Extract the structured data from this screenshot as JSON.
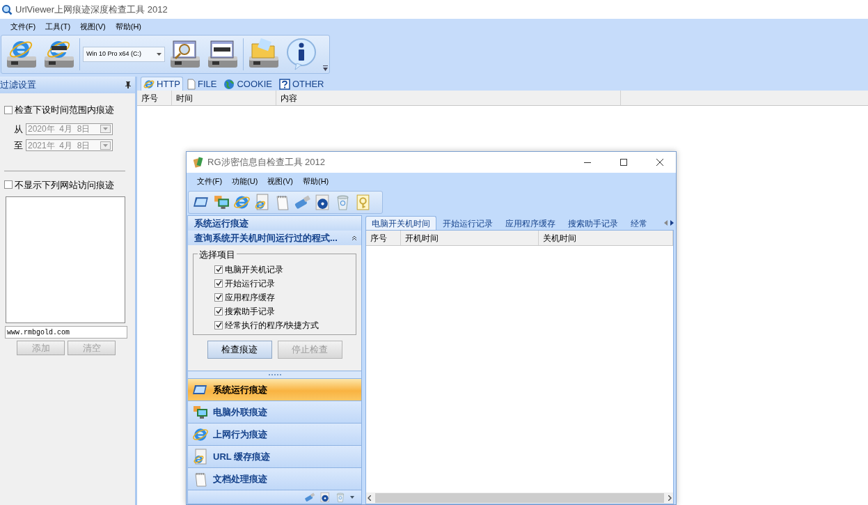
{
  "window": {
    "title": "UrlViewer上网痕迹深度检查工具 2012"
  },
  "menu": [
    "文件(F)",
    "工具(T)",
    "视图(V)",
    "帮助(H)"
  ],
  "toolbar": {
    "drive_select": {
      "value": "Win 10 Pro x64 (C:)"
    }
  },
  "filter_panel": {
    "title": "过滤设置",
    "time_filter": {
      "label": "检查下设时间范围内痕迹",
      "checked": false
    },
    "date_from": {
      "label": "从",
      "value": "2020年  4月  8日",
      "disabled": true
    },
    "date_to": {
      "label": "至",
      "value": "2021年  4月  8日",
      "disabled": true
    },
    "site_filter": {
      "label": "不显示下列网站访问痕迹",
      "checked": false
    },
    "site_input": {
      "value": "www.rmbgold.com"
    },
    "buttons": [
      {
        "label": "添加",
        "disabled": true
      },
      {
        "label": "清空",
        "disabled": true
      }
    ]
  },
  "tabs": [
    {
      "label": "HTTP",
      "selected": true
    },
    {
      "label": "FILE",
      "selected": false
    },
    {
      "label": "COOKIE",
      "selected": false
    },
    {
      "label": "OTHER",
      "selected": false
    }
  ],
  "table": {
    "columns": [
      "序号",
      "时间",
      "内容"
    ]
  },
  "dialog": {
    "title": "RG涉密信息自检查工具 2012",
    "menu": [
      "文件(F)",
      "功能(U)",
      "视图(V)",
      "帮助(H)"
    ],
    "side_panel": {
      "header": "系统运行痕迹",
      "section": {
        "title": "查询系统开关机时间运行过的程式...",
        "expanded": true
      },
      "group": {
        "title": "选择项目",
        "items": [
          {
            "label": "电脑开关机记录",
            "checked": true
          },
          {
            "label": "开始运行记录",
            "checked": true
          },
          {
            "label": "应用程序缓存",
            "checked": true
          },
          {
            "label": "搜索助手记录",
            "checked": true
          },
          {
            "label": "经常执行的程序/快捷方式",
            "checked": true
          }
        ]
      },
      "buttons": [
        {
          "label": "检查痕迹",
          "disabled": false
        },
        {
          "label": "停止检查",
          "disabled": true
        }
      ],
      "nav": [
        {
          "label": "系统运行痕迹",
          "selected": true
        },
        {
          "label": "电脑外联痕迹",
          "selected": false
        },
        {
          "label": "上网行为痕迹",
          "selected": false
        },
        {
          "label": "URL 缓存痕迹",
          "selected": false
        },
        {
          "label": "文档处理痕迹",
          "selected": false
        }
      ]
    },
    "tabs": [
      {
        "label": "电脑开关机时间",
        "selected": true
      },
      {
        "label": "开始运行记录",
        "selected": false
      },
      {
        "label": "应用程序缓存",
        "selected": false
      },
      {
        "label": "搜索助手记录",
        "selected": false
      },
      {
        "label": "经常",
        "selected": false
      }
    ],
    "table": {
      "columns": [
        "序号",
        "开机时间",
        "关机时间"
      ]
    }
  }
}
